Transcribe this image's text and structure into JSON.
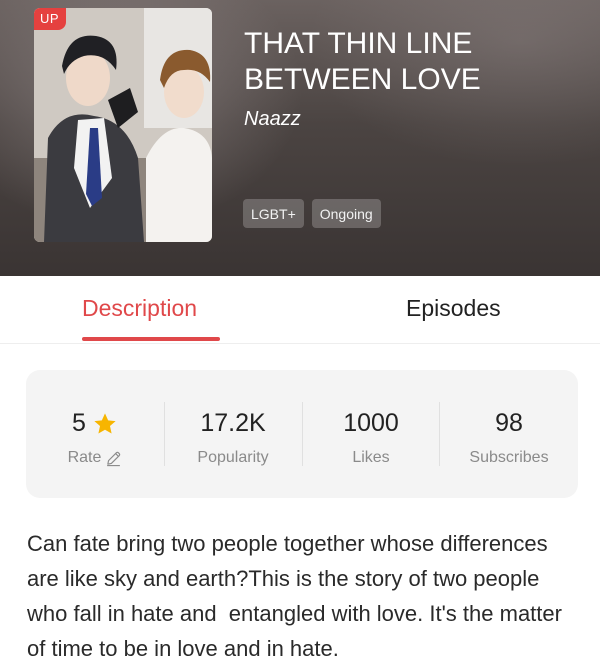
{
  "header": {
    "badge": "UP",
    "title": "THAT THIN LINE BETWEEN LOVE",
    "author": "Naazz",
    "tags": [
      "LGBT+",
      "Ongoing"
    ]
  },
  "tabs": [
    {
      "label": "Description",
      "active": true
    },
    {
      "label": "Episodes",
      "active": false
    }
  ],
  "stats": {
    "rate": {
      "value": "5",
      "label": "Rate"
    },
    "popularity": {
      "value": "17.2K",
      "label": "Popularity"
    },
    "likes": {
      "value": "1000",
      "label": "Likes"
    },
    "subscribes": {
      "value": "98",
      "label": "Subscribes"
    }
  },
  "description": "Can fate bring two people together whose differences are like sky and earth?This is the story of two people who fall in hate and  entangled with love. It's the matter of time to be in love and in hate.",
  "colors": {
    "accent": "#e0484a",
    "badge": "#e5413f",
    "star": "#f7b500",
    "stats_background": "#f4f4f4"
  },
  "icons": [
    "star-icon",
    "pencil-icon"
  ]
}
